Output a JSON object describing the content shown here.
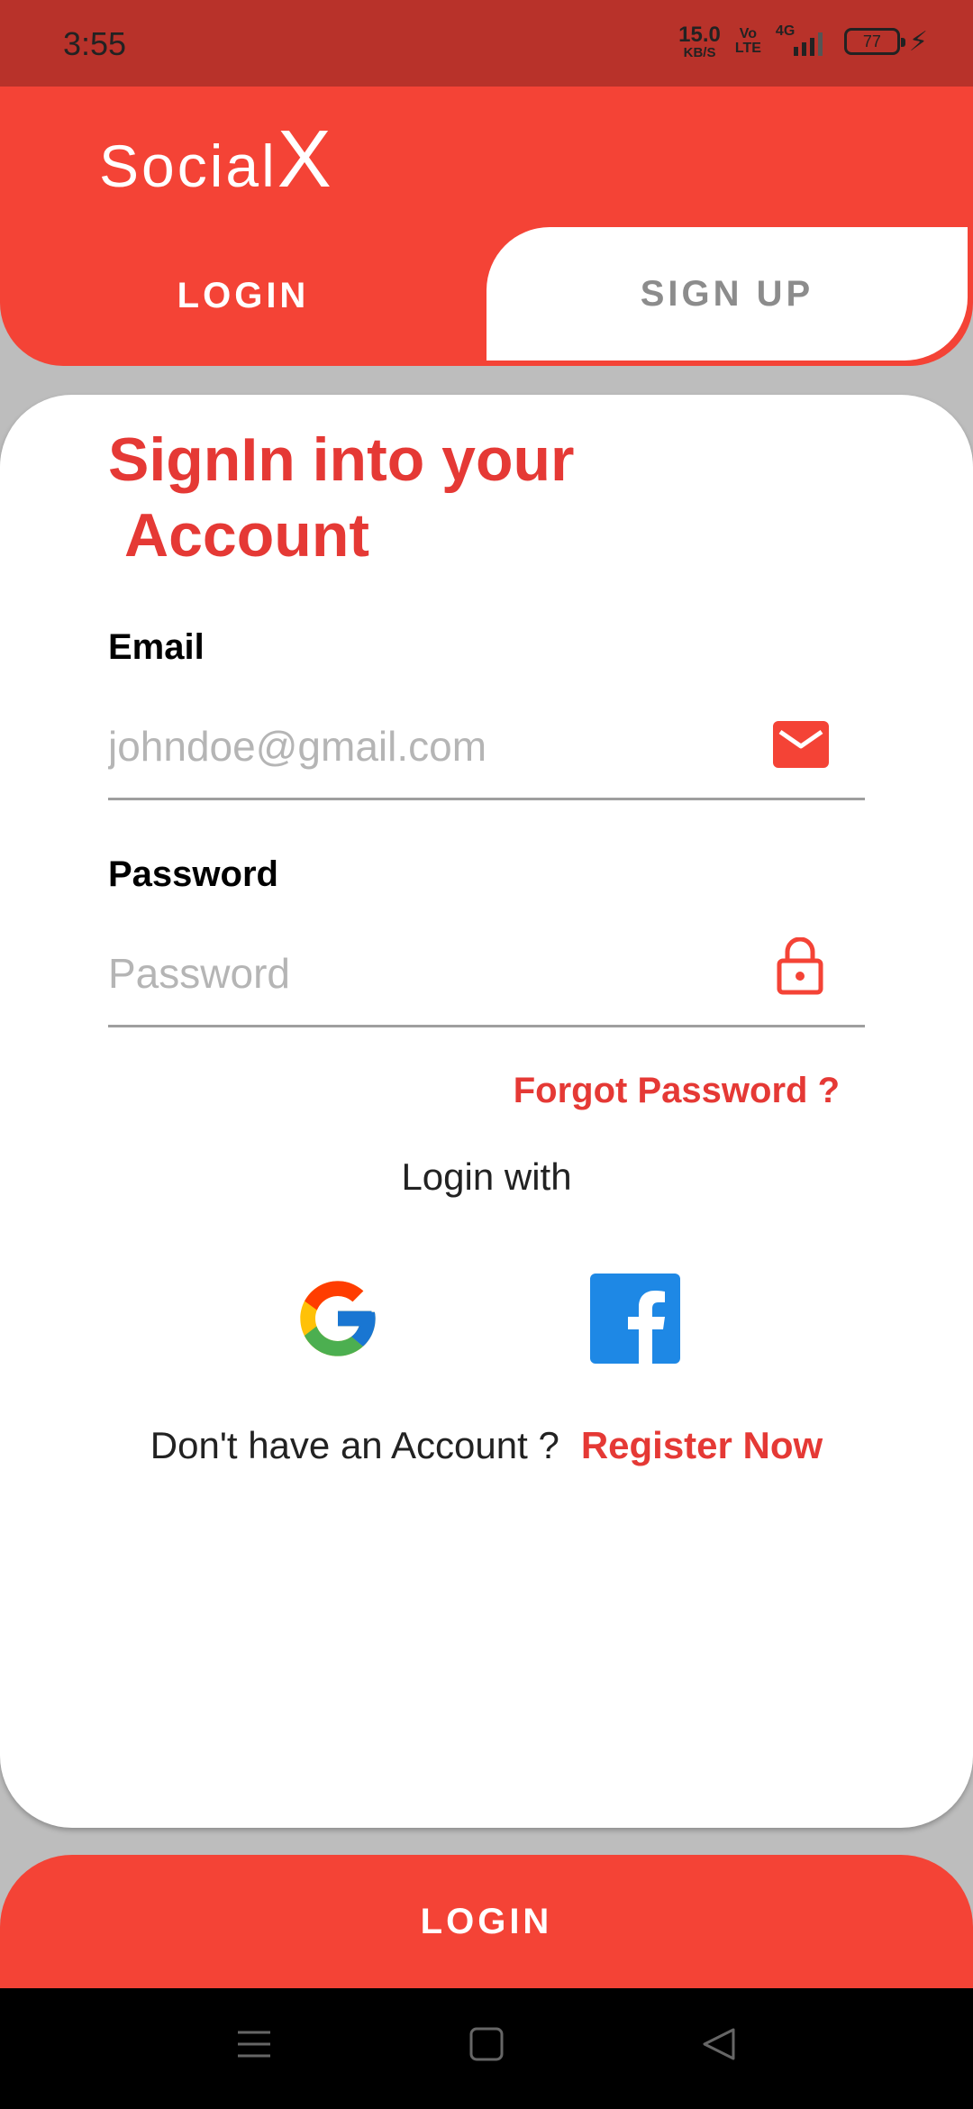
{
  "status": {
    "time": "3:55",
    "net_speed": "15.0",
    "net_unit": "KB/S",
    "volte_top": "Vo",
    "volte_bottom": "LTE",
    "network": "4G",
    "battery": "77"
  },
  "header": {
    "brand_social": "Social",
    "brand_x": "X",
    "tabs": [
      {
        "label": "LOGIN",
        "active": true
      },
      {
        "label": "SIGN UP",
        "active": false
      }
    ]
  },
  "form": {
    "title_line1": "SignIn into your",
    "title_line2": "Account",
    "email_label": "Email",
    "email_placeholder": "johndoe@gmail.com",
    "password_label": "Password",
    "password_placeholder": "Password",
    "forgot": "Forgot Password ?",
    "login_with": "Login with",
    "no_account": "Don't have an Account ?",
    "register": "Register Now"
  },
  "login_button": "LOGIN",
  "colors": {
    "accent": "#f44336",
    "heading": "#e53935",
    "statusbar": "#b8322a"
  },
  "icons": [
    "mail-icon",
    "lock-icon",
    "google-icon",
    "facebook-icon",
    "menu-nav-icon",
    "home-nav-icon",
    "back-nav-icon"
  ]
}
